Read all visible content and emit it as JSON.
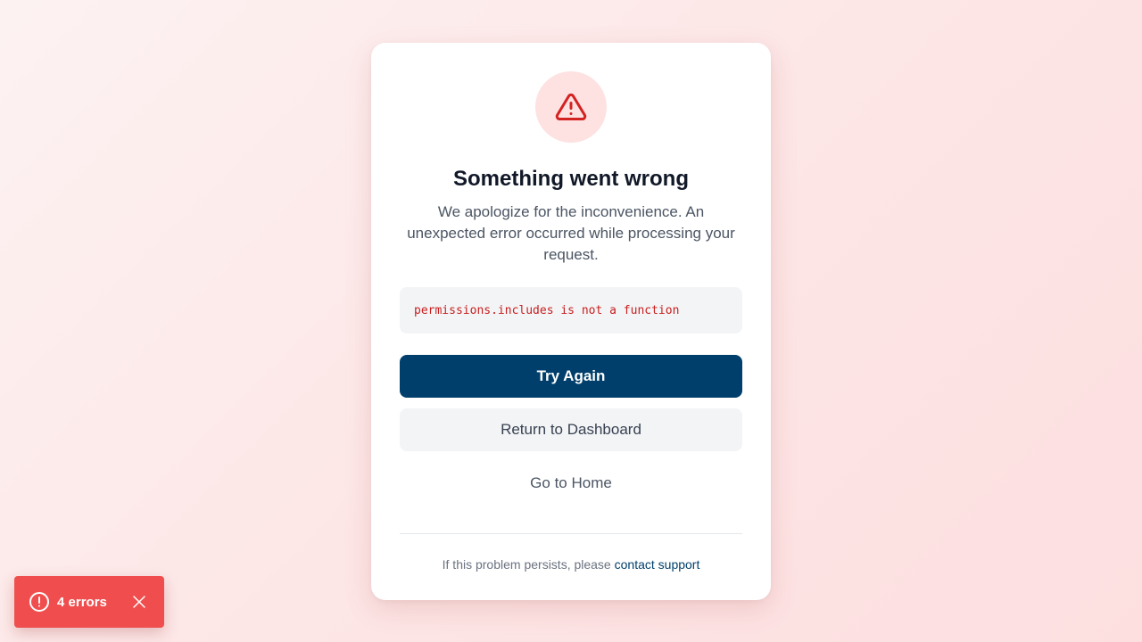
{
  "error_card": {
    "icon": "warning-triangle-icon",
    "title": "Something went wrong",
    "description": "We apologize for the inconvenience. An unexpected error occurred while processing your request.",
    "error_message": "permissions.includes is not a function",
    "try_again_label": "Try Again",
    "dashboard_label": "Return to Dashboard",
    "home_label": "Go to Home",
    "footer_prefix": "If this problem persists, please ",
    "footer_link": "contact support"
  },
  "toast": {
    "icon": "alert-circle-icon",
    "label": "4 errors",
    "close_icon": "close-icon"
  },
  "colors": {
    "primary": "#003f6b",
    "danger": "#c81e1e",
    "toast_bg": "#f04e4e",
    "icon_bg": "#fee2e2"
  }
}
